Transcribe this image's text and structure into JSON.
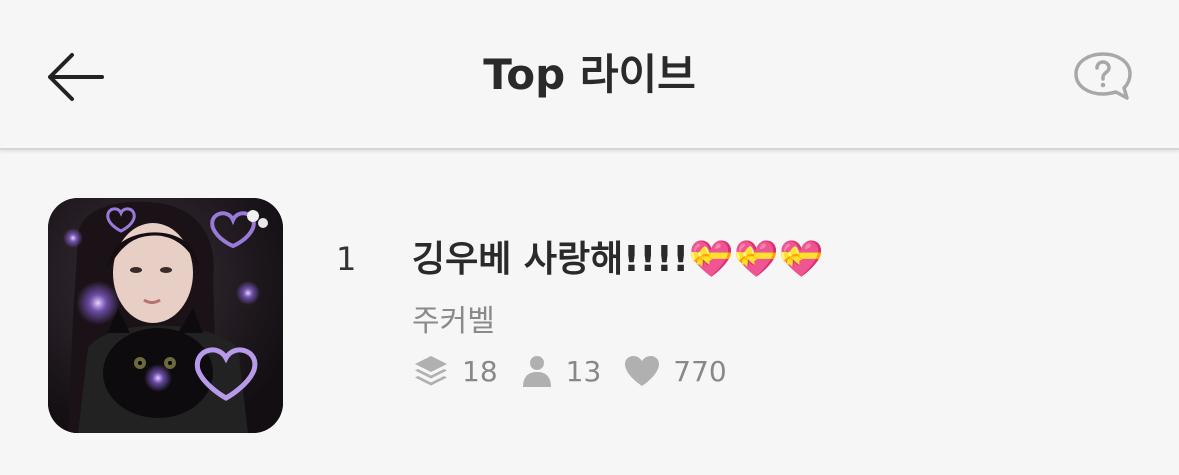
{
  "header": {
    "title": "Top 라이브",
    "back_icon": "arrow-left-icon",
    "help_icon": "question-bubble-icon"
  },
  "colors": {
    "background": "#f6f6f6",
    "title_text": "#2a2a2a",
    "muted_text": "#888888",
    "icon_gray": "#b0b0b0"
  },
  "items": [
    {
      "rank": "1",
      "title": "깅우베 사랑해!!!!💝💝💝",
      "host": "주커벨",
      "stats": {
        "layers_icon": "layers-icon",
        "layers": "18",
        "listeners_icon": "person-icon",
        "listeners": "13",
        "likes_icon": "heart-icon",
        "likes": "770"
      }
    }
  ]
}
